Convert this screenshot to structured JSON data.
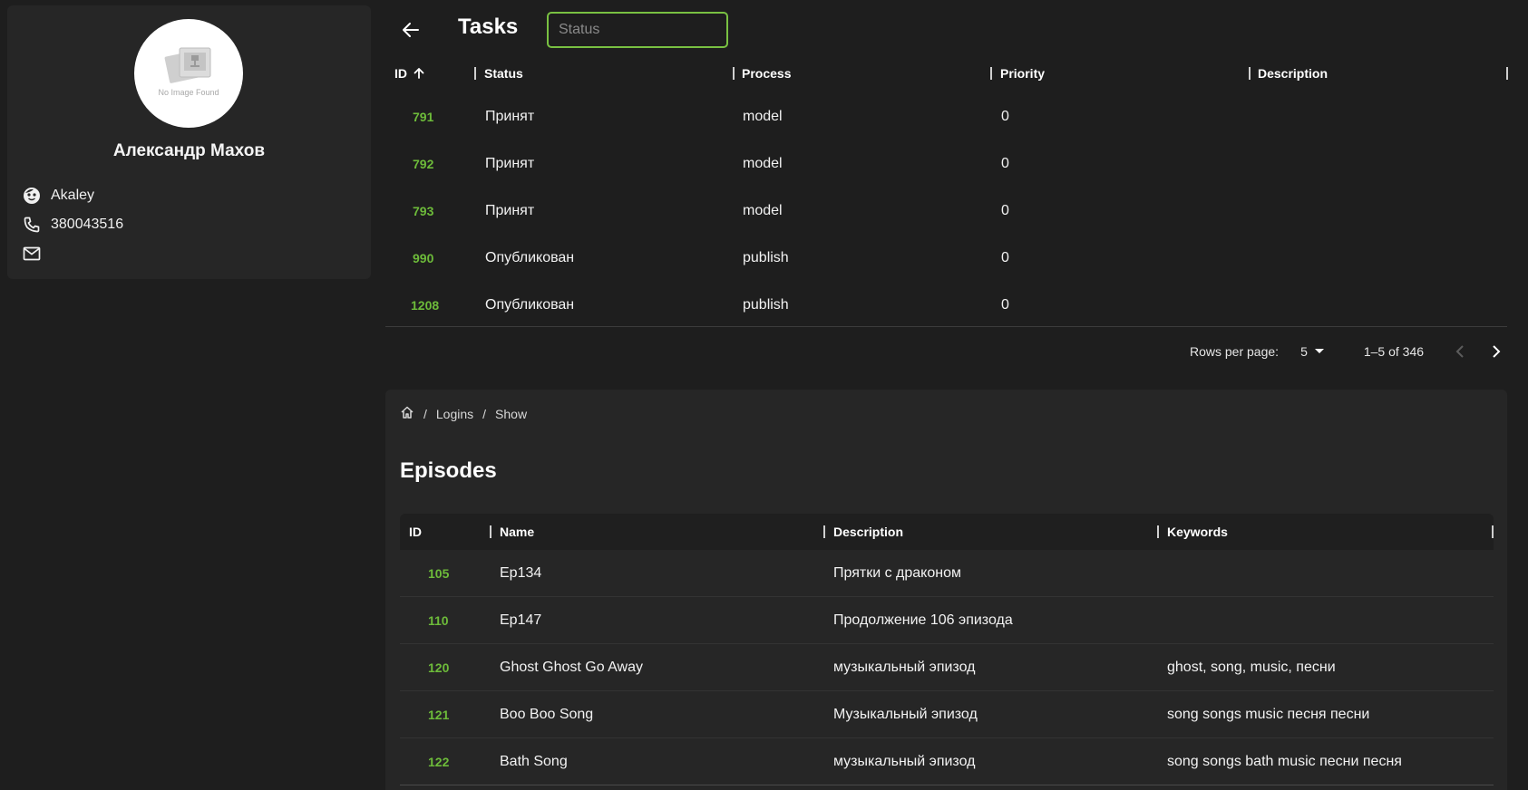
{
  "profile": {
    "avatar_text": "No Image Found",
    "name": "Александр Махов",
    "username": "Akaley",
    "phone": "380043516",
    "email": ""
  },
  "tasks": {
    "title": "Tasks",
    "filter_placeholder": "Status",
    "columns": [
      "ID",
      "Status",
      "Process",
      "Priority",
      "Description"
    ],
    "rows": [
      {
        "id": "791",
        "status": "Принят",
        "process": "model",
        "priority": "0",
        "description": ""
      },
      {
        "id": "792",
        "status": "Принят",
        "process": "model",
        "priority": "0",
        "description": ""
      },
      {
        "id": "793",
        "status": "Принят",
        "process": "model",
        "priority": "0",
        "description": ""
      },
      {
        "id": "990",
        "status": "Опубликован",
        "process": "publish",
        "priority": "0",
        "description": ""
      },
      {
        "id": "1208",
        "status": "Опубликован",
        "process": "publish",
        "priority": "0",
        "description": ""
      }
    ],
    "pagination": {
      "rows_per_page_label": "Rows per page:",
      "rows_per_page_value": "5",
      "range": "1–5 of 346"
    }
  },
  "breadcrumb": {
    "items": [
      "Logins",
      "Show"
    ],
    "separator": "/"
  },
  "episodes": {
    "title": "Episodes",
    "columns": [
      "ID",
      "Name",
      "Description",
      "Keywords"
    ],
    "rows": [
      {
        "id": "105",
        "name": "Ep134",
        "description": "Прятки с драконом",
        "keywords": ""
      },
      {
        "id": "110",
        "name": "Ep147",
        "description": "Продолжение 106 эпизода",
        "keywords": ""
      },
      {
        "id": "120",
        "name": "Ghost Ghost Go Away",
        "description": "музыкальный эпизод",
        "keywords": "ghost, song, music, песни"
      },
      {
        "id": "121",
        "name": "Boo Boo Song",
        "description": "Музыкальный эпизод",
        "keywords": "song songs music песня песни"
      },
      {
        "id": "122",
        "name": "Bath Song",
        "description": "музыкальный эпизод",
        "keywords": "song songs bath music песни песня"
      }
    ]
  },
  "colors": {
    "accent": "#6dbb3a",
    "input_border": "#79c142",
    "background": "#1e1e1e",
    "card": "#262626"
  }
}
